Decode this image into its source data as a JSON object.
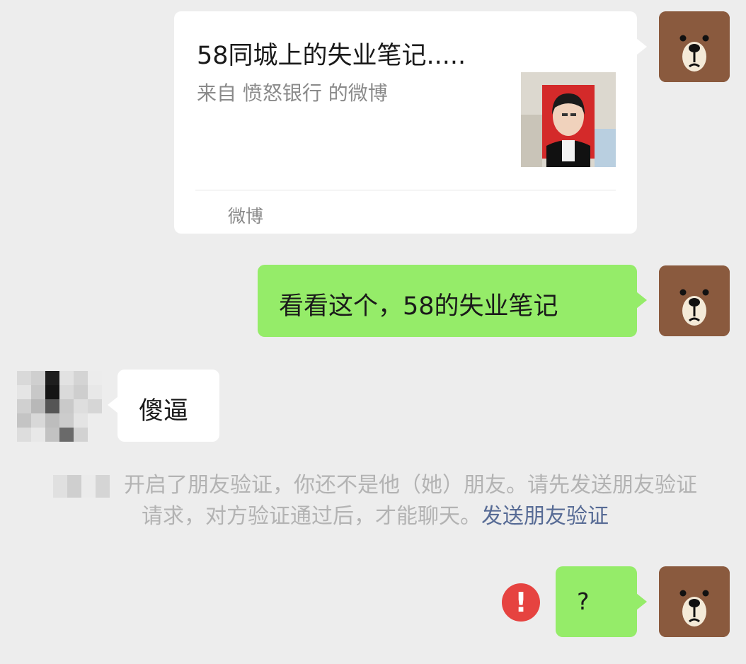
{
  "messages": [
    {
      "type": "card",
      "title": "58同城上的失业笔记.....",
      "subtitle": "来自 愤怒银行 的微博",
      "source": "微博"
    },
    {
      "type": "text",
      "text": "看看这个，58的失业笔记"
    },
    {
      "type": "text",
      "text": "傻逼"
    },
    {
      "type": "text",
      "text": "?"
    }
  ],
  "notice": {
    "text": "开启了朋友验证，你还不是他（她）朋友。请先发送朋友验证请求，对方验证通过后，才能聊天。",
    "link": "发送朋友验证"
  },
  "icons": {
    "self_avatar": "brown-bear-avatar-icon",
    "error": "exclamation-error-icon"
  },
  "colors": {
    "background": "#ededed",
    "sent_bubble": "#95ec69",
    "received_bubble": "#ffffff",
    "error": "#e64340",
    "link": "#576b95"
  },
  "error_glyph": "!"
}
